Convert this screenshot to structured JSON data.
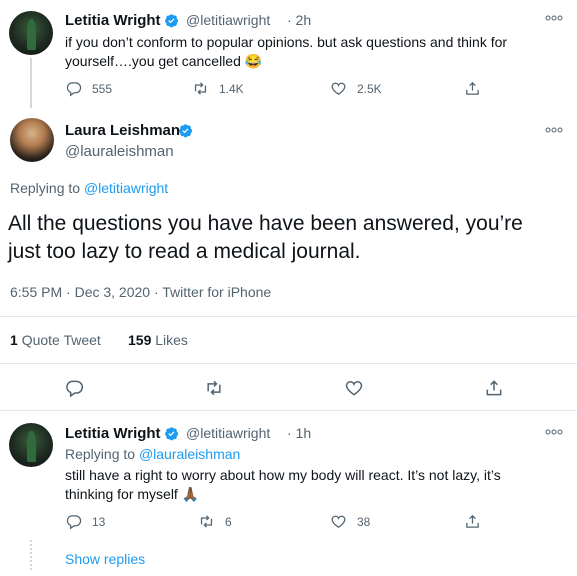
{
  "tweet1": {
    "name": "Letitia Wright",
    "handle": "@letitiawright",
    "time": "· 2h",
    "text_line1": "if you don’t conform to popular opinions. but ask questions and think for",
    "text_line2": "yourself….you get cancelled 😂",
    "reply_count": "555",
    "retweet_count": "1.4K",
    "like_count": "2.5K"
  },
  "main_tweet": {
    "name": "Laura Leishman",
    "handle": "@lauraleishman",
    "replying_prefix": "Replying to",
    "replying_to": "@letitiawright",
    "text_line1": "All the questions you have have been answered, you’re",
    "text_line2": "just too lazy to read a medical journal.",
    "meta": "6:55 PM · Dec 3, 2020 · Twitter for iPhone",
    "quote_count": "1",
    "quote_label": "Quote Tweet",
    "like_count": "159",
    "like_label": "Likes"
  },
  "reply_tweet": {
    "name": "Letitia Wright",
    "handle": "@letitiawright",
    "time": "· 1h",
    "replying_prefix": "Replying to",
    "replying_to": "@lauraleishman",
    "text_line1": "still have a right to worry about how my body will react. It’s not lazy, it’s",
    "text_line2": "thinking for myself 🙏🏾",
    "reply_count": "13",
    "retweet_count": "6",
    "like_count": "38"
  },
  "show_replies": "Show replies",
  "colors": {
    "accent": "#1d9bf0",
    "secondary_text": "#536471",
    "border": "#e3e8ec"
  },
  "icons": [
    "verified-badge-icon",
    "more-icon",
    "reply-icon",
    "retweet-icon",
    "like-icon",
    "share-icon"
  ]
}
